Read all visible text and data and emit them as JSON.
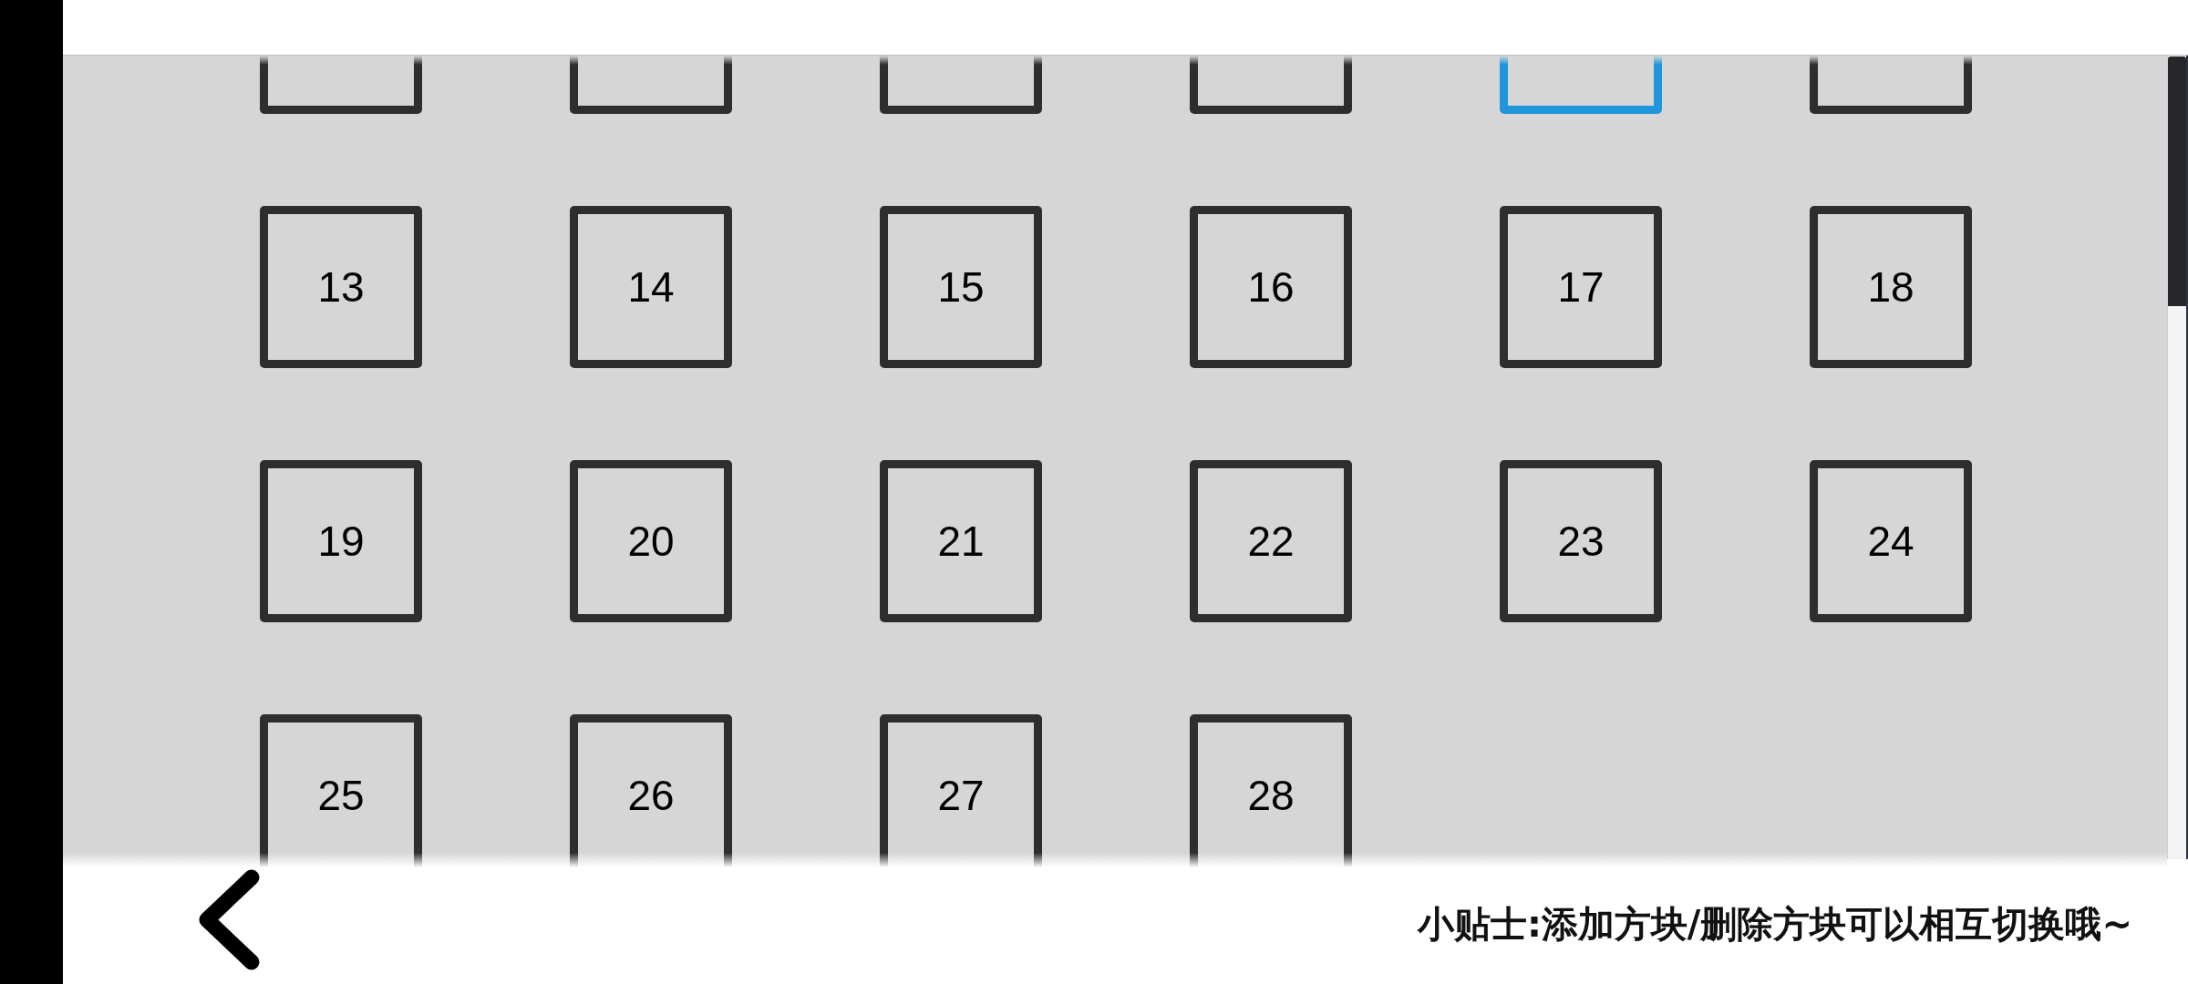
{
  "tiles": [
    {
      "selected": false
    },
    {
      "selected": false
    },
    {
      "selected": false
    },
    {
      "selected": false
    },
    {
      "selected": true
    },
    {
      "selected": false
    },
    {
      "label": "13",
      "selected": false
    },
    {
      "label": "14",
      "selected": false
    },
    {
      "label": "15",
      "selected": false
    },
    {
      "label": "16",
      "selected": false
    },
    {
      "label": "17",
      "selected": false
    },
    {
      "label": "18",
      "selected": false
    },
    {
      "label": "19",
      "selected": false
    },
    {
      "label": "20",
      "selected": false
    },
    {
      "label": "21",
      "selected": false
    },
    {
      "label": "22",
      "selected": false
    },
    {
      "label": "23",
      "selected": false
    },
    {
      "label": "24",
      "selected": false
    },
    {
      "label": "25",
      "selected": false
    },
    {
      "label": "26",
      "selected": false
    },
    {
      "label": "27",
      "selected": false
    },
    {
      "label": "28",
      "selected": false
    }
  ],
  "tip": "小贴士:添加方块/删除方块可以相互切换哦~"
}
